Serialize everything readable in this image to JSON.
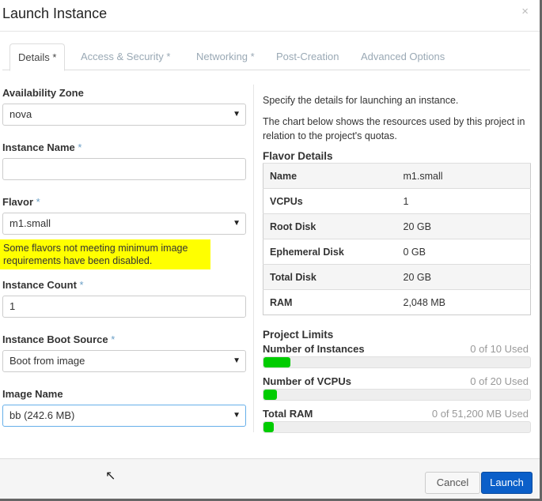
{
  "dialog": {
    "title": "Launch Instance",
    "close": "×"
  },
  "tabs": [
    {
      "label": "Details *"
    },
    {
      "label": "Access & Security *"
    },
    {
      "label": "Networking *"
    },
    {
      "label": "Post-Creation"
    },
    {
      "label": "Advanced Options"
    }
  ],
  "form": {
    "availability_zone": {
      "label": "Availability Zone",
      "value": "nova"
    },
    "instance_name": {
      "label": "Instance Name",
      "req": "*",
      "value": ""
    },
    "flavor": {
      "label": "Flavor",
      "req": "*",
      "value": "m1.small"
    },
    "warning": "Some flavors not meeting minimum image requirements have been disabled.",
    "instance_count": {
      "label": "Instance Count",
      "req": "*",
      "value": "1"
    },
    "boot_source": {
      "label": "Instance Boot Source",
      "req": "*",
      "value": "Boot from image"
    },
    "image_name": {
      "label": "Image Name",
      "value": "bb (242.6 MB)"
    }
  },
  "info": {
    "line1": "Specify the details for launching an instance.",
    "line2": "The chart below shows the resources used by this project in relation to the project's quotas."
  },
  "flavor_details": {
    "title": "Flavor Details",
    "rows": [
      {
        "k": "Name",
        "v": "m1.small"
      },
      {
        "k": "VCPUs",
        "v": "1"
      },
      {
        "k": "Root Disk",
        "v": "20 GB"
      },
      {
        "k": "Ephemeral Disk",
        "v": "0 GB"
      },
      {
        "k": "Total Disk",
        "v": "20 GB"
      },
      {
        "k": "RAM",
        "v": "2,048 MB"
      }
    ]
  },
  "limits": {
    "title": "Project Limits",
    "items": [
      {
        "name": "Number of Instances",
        "used": "0 of 10 Used",
        "fill_pct": 10
      },
      {
        "name": "Number of VCPUs",
        "used": "0 of 20 Used",
        "fill_pct": 5
      },
      {
        "name": "Total RAM",
        "used": "0 of 51,200 MB Used",
        "fill_pct": 4
      }
    ]
  },
  "footer": {
    "cancel": "Cancel",
    "launch": "Launch"
  },
  "colors": {
    "accent": "#0b5fc9",
    "bar": "#00cc00",
    "warning": "#ffff00"
  }
}
